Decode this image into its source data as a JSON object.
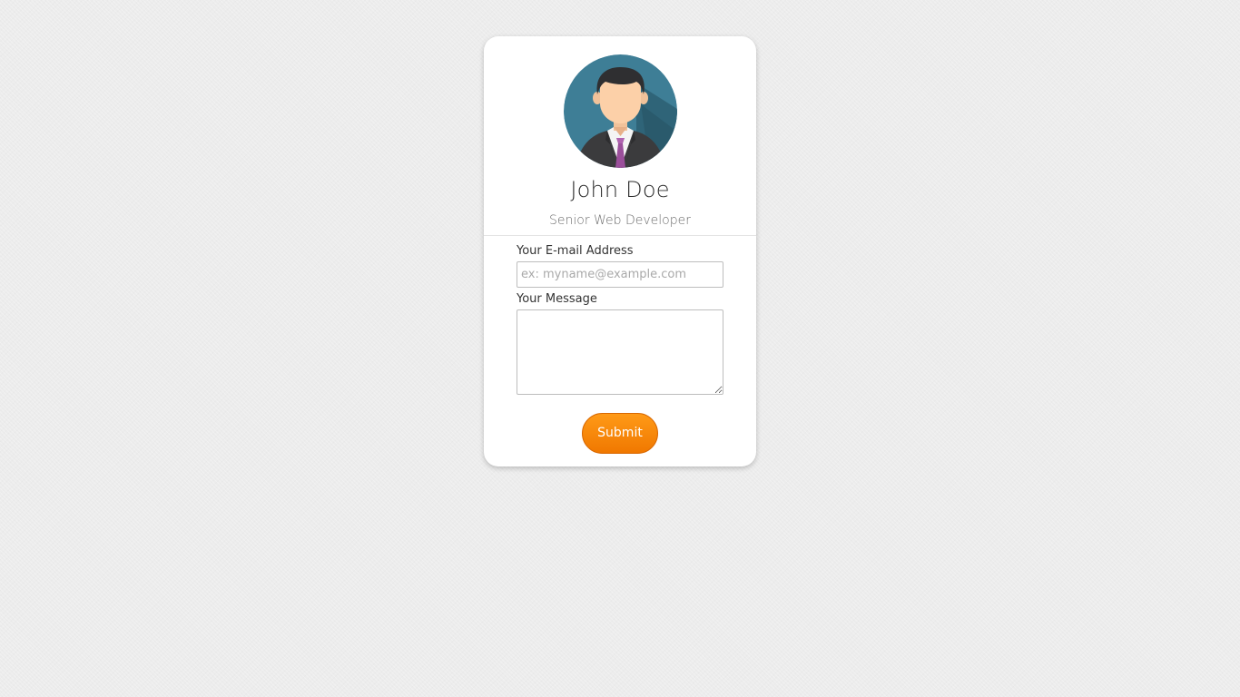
{
  "profile": {
    "name": "John Doe",
    "role": "Senior Web Developer",
    "avatar_icon": "businessman-avatar-icon"
  },
  "form": {
    "email_label": "Your E-mail Address",
    "email_placeholder": "ex: myname@example.com",
    "email_value": "",
    "message_label": "Your Message",
    "message_value": "",
    "submit_label": "Submit"
  },
  "colors": {
    "background": "#ececec",
    "card": "#ffffff",
    "avatar_bg": "#3e7e96",
    "tie": "#9b4f9b",
    "submit_top": "#ff9a17",
    "submit_bottom": "#f07800"
  }
}
